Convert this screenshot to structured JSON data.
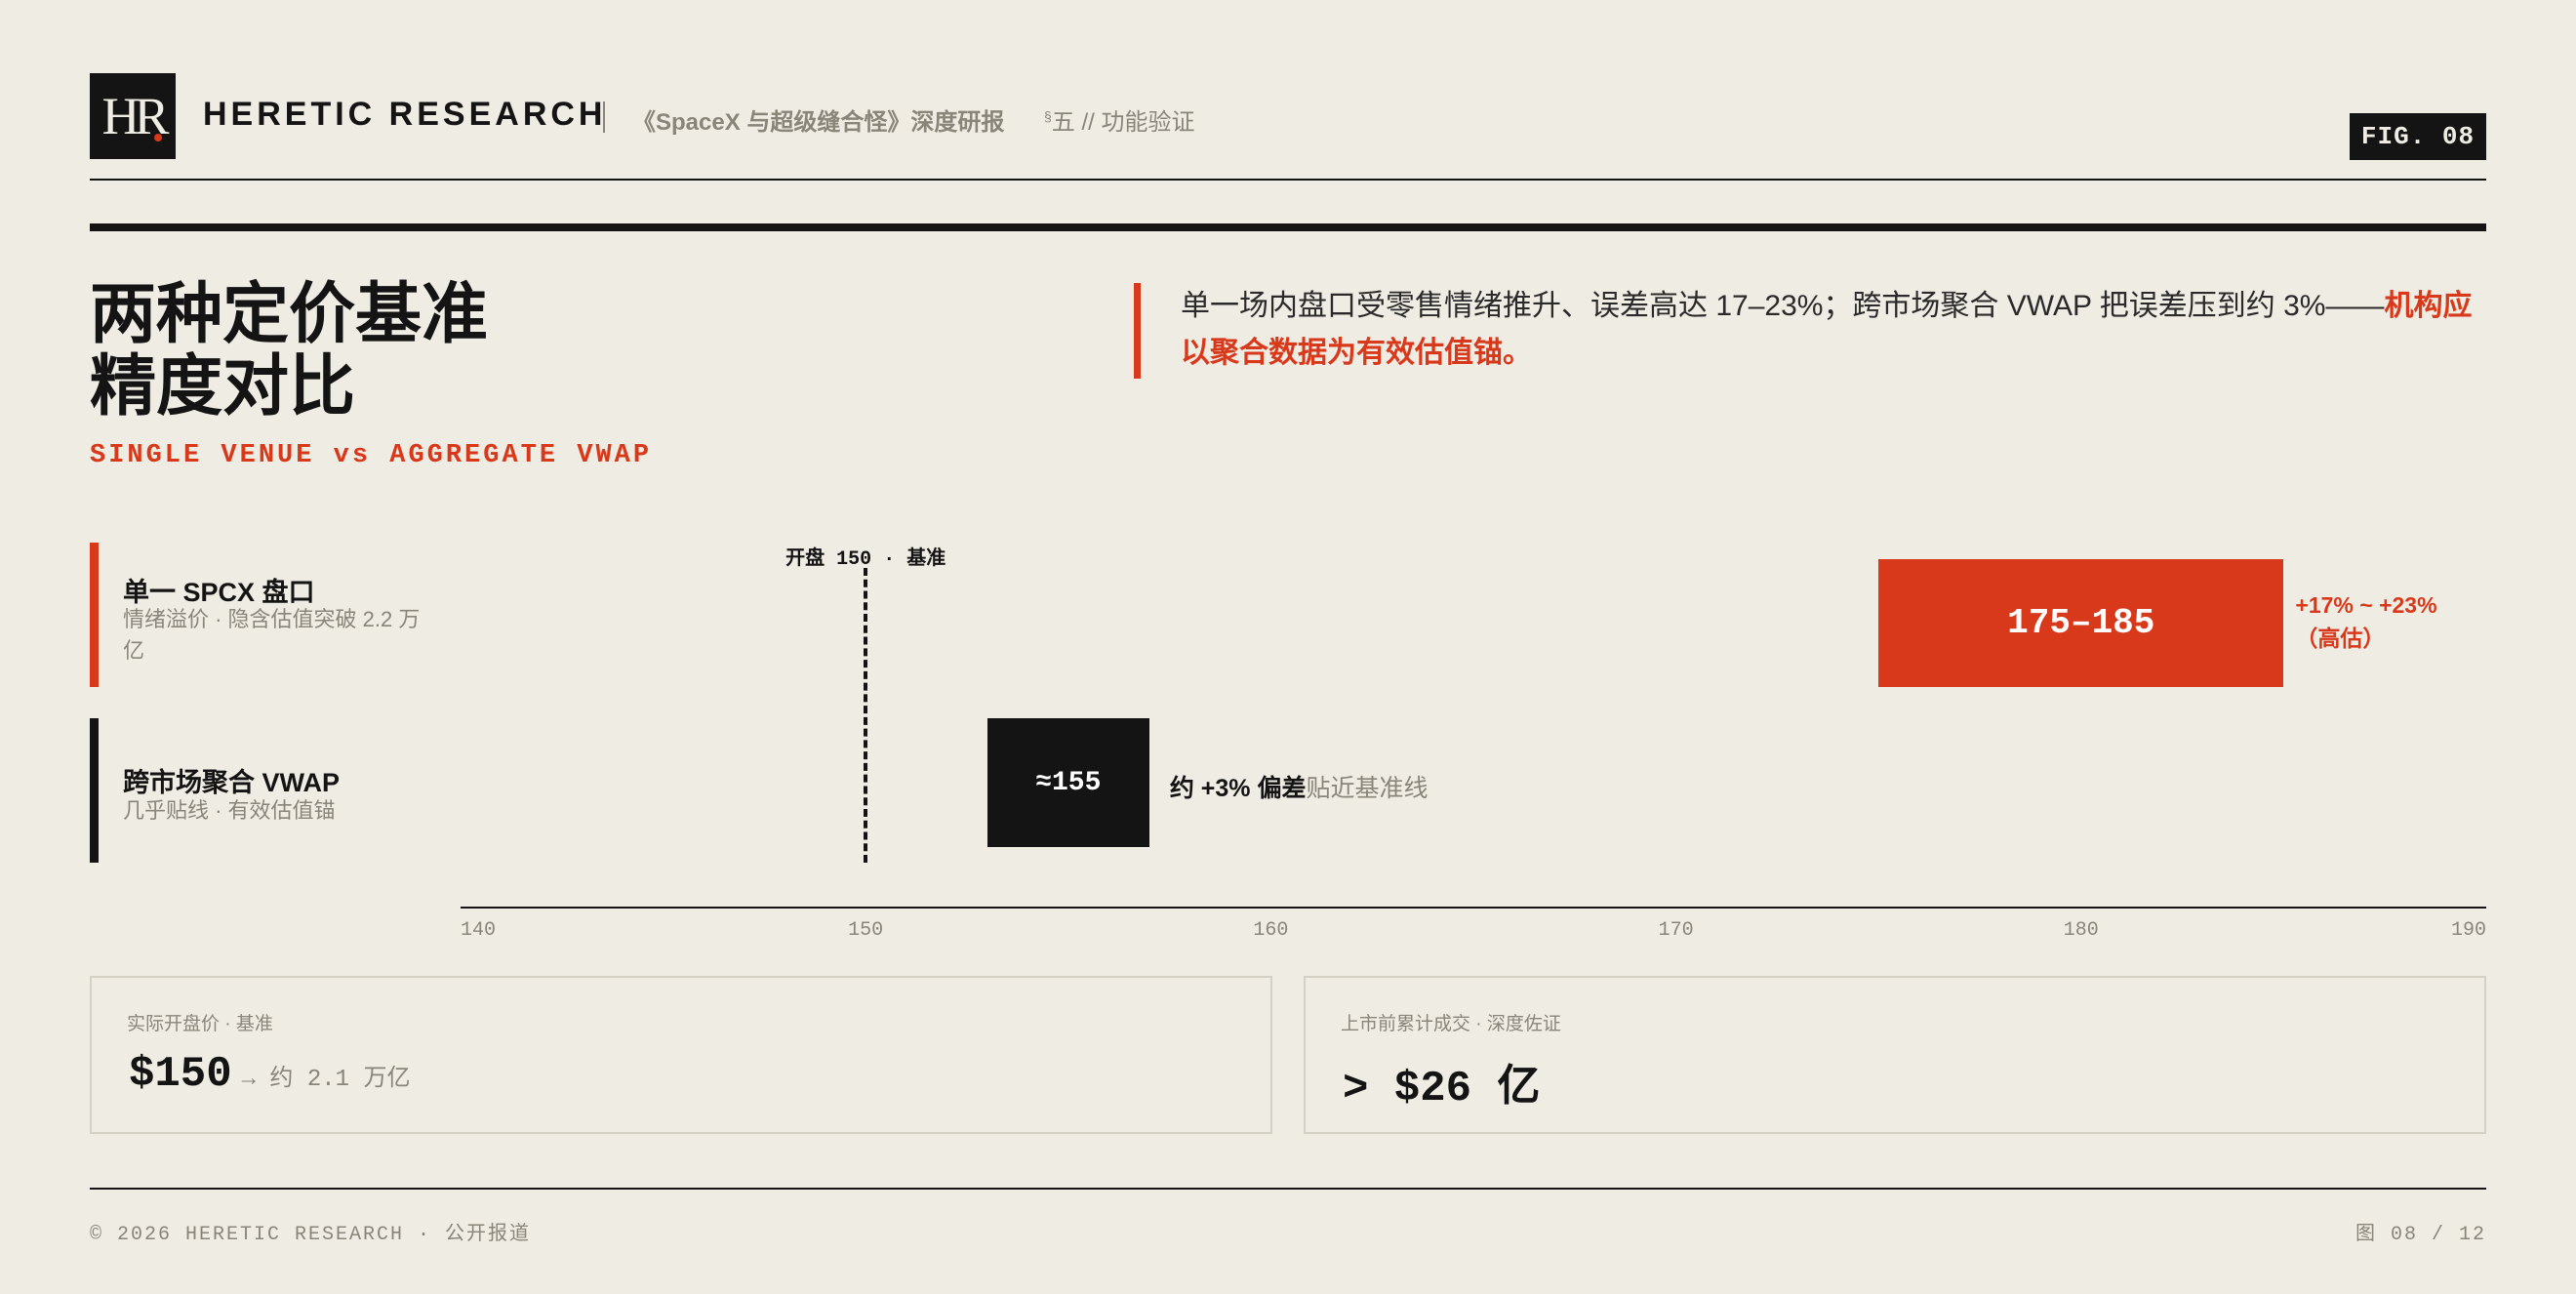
{
  "header": {
    "logo_text": "HR",
    "brand": "HERETIC RESEARCH",
    "doc_title": "《SpaceX 与超级缝合怪》深度研报",
    "section_mark": "§",
    "section": "五 // 功能验证",
    "fig_badge": "FIG. 08"
  },
  "title": {
    "line1": "两种定价基准",
    "line2": "精度对比",
    "subtitle": "SINGLE VENUE vs AGGREGATE VWAP"
  },
  "callout": {
    "text": "单一场内盘口受零售情绪推升、误差高达 17–23%；跨市场聚合 VWAP 把误差压到约 3%——",
    "highlight": "机构应以聚合数据为有效估值锚。"
  },
  "chart_data": {
    "type": "bar",
    "orientation": "horizontal-range",
    "xlim": [
      140,
      190
    ],
    "xticks": [
      "140",
      "150",
      "160",
      "170",
      "180",
      "190"
    ],
    "reference_value": 150,
    "reference_label": "开盘 150 · 基准",
    "series": [
      {
        "row_title": "单一 SPCX 盘口",
        "row_subtitle": "情绪溢价 · 隐含估值突破 2.2 万亿",
        "low": 175,
        "high": 185,
        "bar_label": "175–185",
        "annotation_line1": "+17% ~ +23%",
        "annotation_line2": "（高估）",
        "color": "#d9391b"
      },
      {
        "row_title": "跨市场聚合 VWAP",
        "row_subtitle": "几乎贴线 · 有效估值锚",
        "low": 153,
        "high": 157,
        "bar_label": "≈155",
        "annotation_strong": "约 +3% 偏差",
        "annotation_soft": "贴近基准线",
        "color": "#141414"
      }
    ]
  },
  "cards": [
    {
      "label": "实际开盘价 · 基准",
      "value": "$150",
      "note": "→ 约 2.1 万亿"
    },
    {
      "label": "上市前累计成交 · 深度佐证",
      "value": "> $26 亿",
      "note": ""
    }
  ],
  "footer": {
    "left": "© 2026 HERETIC RESEARCH · 公开报道",
    "right": "图 08 / 12"
  },
  "colors": {
    "accent": "#d9391b",
    "ink": "#141414",
    "paper": "#efece4",
    "muted": "#8a8579"
  }
}
